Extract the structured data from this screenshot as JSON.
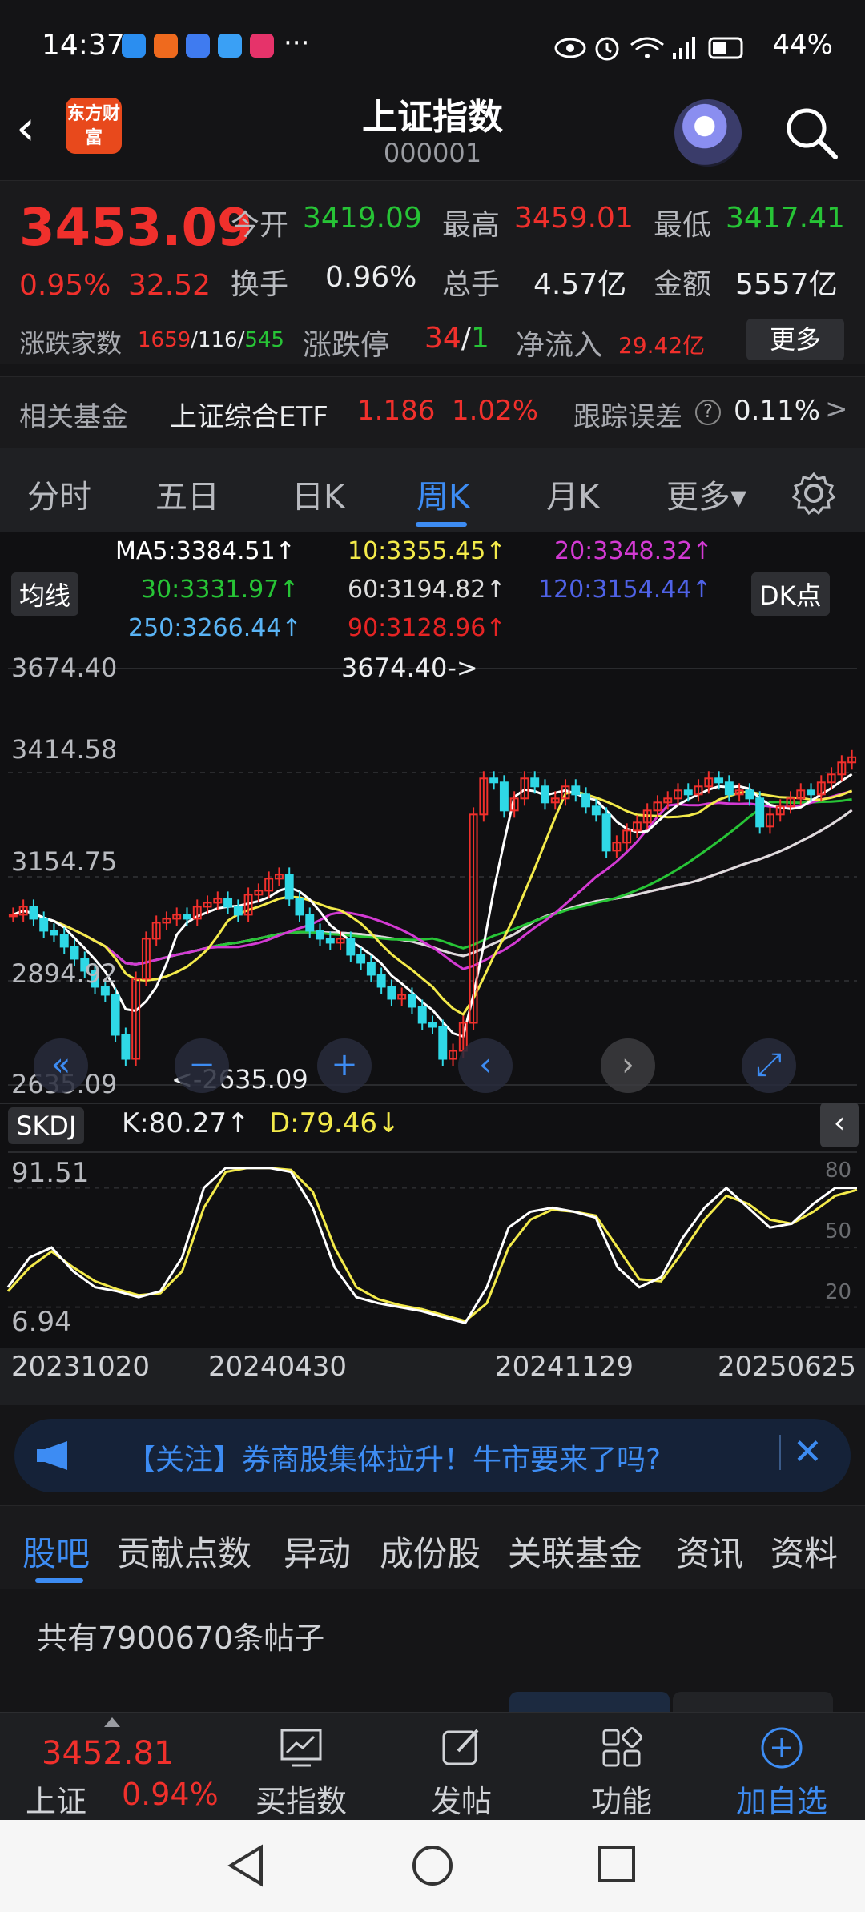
{
  "status_bar": {
    "time": "14:37",
    "dots": "···",
    "battery": "44%",
    "signal_icons": [
      "eye-icon",
      "alarm-icon",
      "wifi-icon",
      "4g-signal-icon",
      "battery-icon"
    ],
    "app_icons": [
      "snowflake-app-icon",
      "orange-app-icon",
      "blue-app-icon",
      "cloud-app-icon",
      "video-app-icon"
    ]
  },
  "header": {
    "back": "‹",
    "logo": "东方财富",
    "title": "上证指数",
    "code": "000001"
  },
  "quote": {
    "price": "3453.09",
    "pct": "0.95%",
    "change": "32.52",
    "open_label": "今开",
    "open": "3419.09",
    "high_label": "最高",
    "high": "3459.01",
    "low_label": "最低",
    "low": "3417.41",
    "turnover_label": "换手",
    "turnover": "0.96%",
    "volume_label": "总手",
    "volume": "4.57亿",
    "amount_label": "金额",
    "amount": "5557亿",
    "breadth_label": "涨跌家数",
    "breadth_up": "1659",
    "breadth_flat": "116",
    "breadth_down": "545",
    "limit_label": "涨跌停",
    "limit_up": "34",
    "limit_down": "1",
    "netflow_label": "净流入",
    "netflow": "29.42亿",
    "more": "更多"
  },
  "fund": {
    "label": "相关基金",
    "name": "上证综合ETF",
    "price": "1.186",
    "pct": "1.02%",
    "error_label": "跟踪误差",
    "error_value": "0.11%",
    "arrow": ">"
  },
  "period_tabs": [
    "分时",
    "五日",
    "日K",
    "周K",
    "月K",
    "更多▾"
  ],
  "active_period": "周K",
  "chart": {
    "ma_button": "均线",
    "dk_button": "DK点",
    "ma": [
      {
        "text": "MA5:3384.51↑",
        "color": "#ffffff"
      },
      {
        "text": "10:3355.45↑",
        "color": "#f3ea4a"
      },
      {
        "text": "20:3348.32↑",
        "color": "#d33ad3"
      },
      {
        "text": "30:3331.97↑",
        "color": "#27c436"
      },
      {
        "text": "60:3194.82↑",
        "color": "#dcdcdc"
      },
      {
        "text": "120:3154.44↑",
        "color": "#4f62e6"
      },
      {
        "text": "250:3266.44↑",
        "color": "#5ab4f5"
      },
      {
        "text": "90:3128.96↑",
        "color": "#e52424"
      }
    ],
    "y_ticks": [
      "3674.40",
      "3414.58",
      "3154.75",
      "2894.92",
      "2635.09"
    ],
    "max_label": "3674.40->",
    "min_label": "<-2635.09",
    "indicator_button": "SKDJ",
    "k_label": "K:80.27↑",
    "d_label": "D:79.46↓",
    "ind_ticks": [
      "91.51",
      "6.94"
    ],
    "ind_levels": [
      "80",
      "50",
      "20"
    ],
    "x_ticks": [
      "20231020",
      "20240430",
      "20241129",
      "20250625"
    ]
  },
  "chart_data": {
    "type": "candlestick",
    "y_range": [
      2635.09,
      3674.4
    ],
    "indicator_range": [
      6.94,
      91.51
    ],
    "closes": [
      3060,
      3080,
      3050,
      3020,
      3010,
      2980,
      2950,
      2920,
      2880,
      2860,
      2760,
      2700,
      2900,
      3000,
      3040,
      3050,
      3060,
      3050,
      3080,
      3090,
      3100,
      3080,
      3060,
      3110,
      3120,
      3150,
      3160,
      3100,
      3060,
      3020,
      3000,
      2990,
      3000,
      2960,
      2940,
      2910,
      2880,
      2850,
      2860,
      2830,
      2790,
      2780,
      2700,
      2720,
      2790,
      3310,
      3400,
      3390,
      3320,
      3350,
      3400,
      3380,
      3340,
      3350,
      3380,
      3360,
      3330,
      3310,
      3220,
      3240,
      3270,
      3290,
      3320,
      3340,
      3350,
      3370,
      3360,
      3380,
      3400,
      3390,
      3360,
      3370,
      3350,
      3280,
      3310,
      3330,
      3350,
      3370,
      3360,
      3390,
      3410,
      3440,
      3453
    ],
    "skdj_k": [
      30,
      45,
      50,
      38,
      30,
      28,
      25,
      28,
      45,
      80,
      90,
      90,
      90,
      88,
      70,
      40,
      25,
      22,
      20,
      18,
      15,
      12,
      30,
      60,
      68,
      70,
      68,
      65,
      40,
      30,
      35,
      55,
      70,
      80,
      70,
      60,
      62,
      72,
      80,
      80
    ],
    "skdj_d": [
      28,
      40,
      48,
      40,
      33,
      29,
      26,
      27,
      38,
      70,
      88,
      90,
      90,
      89,
      78,
      50,
      30,
      24,
      21,
      19,
      16,
      13,
      22,
      50,
      64,
      69,
      68,
      66,
      50,
      34,
      33,
      48,
      64,
      76,
      72,
      64,
      62,
      68,
      76,
      79
    ]
  },
  "notice": {
    "text": "【关注】券商股集体拉升！牛市要来了吗?",
    "close": "✕"
  },
  "bottom_tabs": [
    "股吧",
    "贡献点数",
    "异动",
    "成份股",
    "关联基金",
    "资讯",
    "资料"
  ],
  "active_bottom_tab": "股吧",
  "posts": {
    "count": "共有7900670条帖子"
  },
  "toolbar": {
    "mini_price": "3452.81",
    "mini_name": "上证",
    "mini_pct": "0.94%",
    "buy": "买指数",
    "post": "发帖",
    "func": "功能",
    "watch": "加自选"
  }
}
